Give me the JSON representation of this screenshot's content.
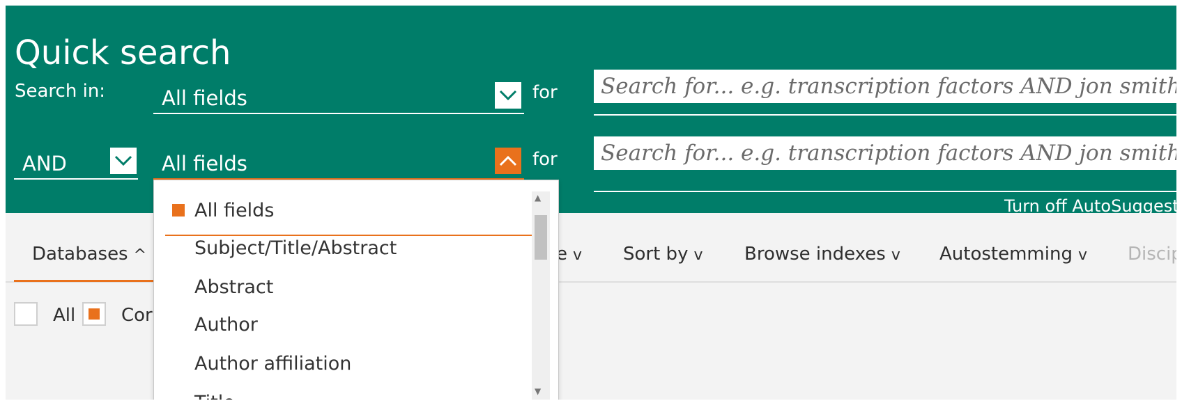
{
  "header": {
    "title": "Quick search",
    "search_in_label": "Search in:",
    "for_label": "for",
    "rows": [
      {
        "field": "All fields",
        "placeholder": "Search for... e.g. transcription factors AND jon smith"
      },
      {
        "operator": "AND",
        "field": "All fields",
        "placeholder": "Search for... e.g. transcription factors AND jon smith"
      }
    ],
    "autosuggest_label": "Turn off AutoSuggest"
  },
  "tabs": [
    {
      "label": "Databases",
      "chevron": "^"
    },
    {
      "label": "e",
      "chevron": "v"
    },
    {
      "label": "Sort by",
      "chevron": "v"
    },
    {
      "label": "Browse indexes",
      "chevron": "v"
    },
    {
      "label": "Autostemming",
      "chevron": "v"
    },
    {
      "label": "Discip"
    }
  ],
  "databases": {
    "all_label": "All",
    "compendex_label": "Cor"
  },
  "dropdown": {
    "items": [
      "All fields",
      "Subject/Title/Abstract",
      "Abstract",
      "Author",
      "Author affiliation",
      "Title"
    ],
    "selected": "All fields"
  },
  "colors": {
    "brand_green": "#007d69",
    "accent_orange": "#e9711c",
    "panel_gray": "#f3f3f3"
  },
  "icons": [
    "chevron-down-icon",
    "chevron-up-icon",
    "scroll-up-arrow-icon",
    "scroll-down-arrow-icon"
  ]
}
